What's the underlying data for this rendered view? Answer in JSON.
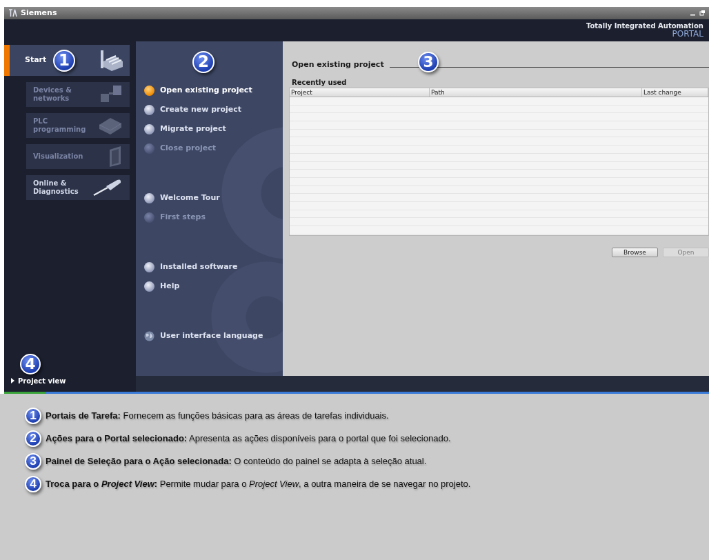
{
  "window": {
    "title": "Siemens",
    "brand_line1": "Totally Integrated Automation",
    "brand_line2": "PORTAL"
  },
  "portals": [
    {
      "label": "Start",
      "kind": "start",
      "selected": true,
      "disabled": false
    },
    {
      "label": "Devices & networks",
      "kind": "devices",
      "selected": false,
      "disabled": true
    },
    {
      "label": "PLC programming",
      "kind": "plc",
      "selected": false,
      "disabled": true
    },
    {
      "label": "Visualization",
      "kind": "visualization",
      "selected": false,
      "disabled": true
    },
    {
      "label": "Online & Diagnostics",
      "kind": "online",
      "selected": false,
      "disabled": false
    }
  ],
  "action_groups": [
    [
      {
        "label": "Open existing project",
        "kind": "bullet",
        "selected": true,
        "disabled": false
      },
      {
        "label": "Create new project",
        "kind": "bullet",
        "selected": false,
        "disabled": false
      },
      {
        "label": "Migrate project",
        "kind": "bullet",
        "selected": false,
        "disabled": false
      },
      {
        "label": "Close project",
        "kind": "bullet",
        "selected": false,
        "disabled": true
      }
    ],
    [
      {
        "label": "Welcome Tour",
        "kind": "bullet",
        "selected": false,
        "disabled": false
      },
      {
        "label": "First steps",
        "kind": "bullet",
        "selected": false,
        "disabled": true
      }
    ],
    [
      {
        "label": "Installed software",
        "kind": "bullet",
        "selected": false,
        "disabled": false
      },
      {
        "label": "Help",
        "kind": "bullet",
        "selected": false,
        "disabled": false
      }
    ],
    [
      {
        "label": "User interface language",
        "kind": "globe",
        "selected": false,
        "disabled": false
      }
    ]
  ],
  "project_view": {
    "label": "Project view"
  },
  "panel": {
    "title": "Open existing project",
    "section": "Recently used",
    "table": {
      "columns": [
        "Project",
        "Path",
        "Last change"
      ]
    },
    "buttons": [
      {
        "label": "Browse",
        "disabled": false
      },
      {
        "label": "Open",
        "disabled": true
      }
    ]
  },
  "markers": {
    "portals": "1",
    "actions": "2",
    "panel": "3",
    "project_view": "4"
  },
  "legend": [
    {
      "number": "1",
      "text": "**Portais de Tarefa:** Fornecem as funções básicas para as áreas de tarefas individuais."
    },
    {
      "number": "2",
      "text": "**Ações para o Portal selecionado:** Apresenta as ações disponíveis para o portal que foi selecionado."
    },
    {
      "number": "3",
      "text": "**Painel de Seleção para o Ação selecionada:** O conteúdo do painel se adapta à seleção atual."
    },
    {
      "number": "4",
      "text": "**Troca para o *Project View*:** Permite mudar para o *Project View*, a outra maneira de se navegar no projeto."
    }
  ]
}
